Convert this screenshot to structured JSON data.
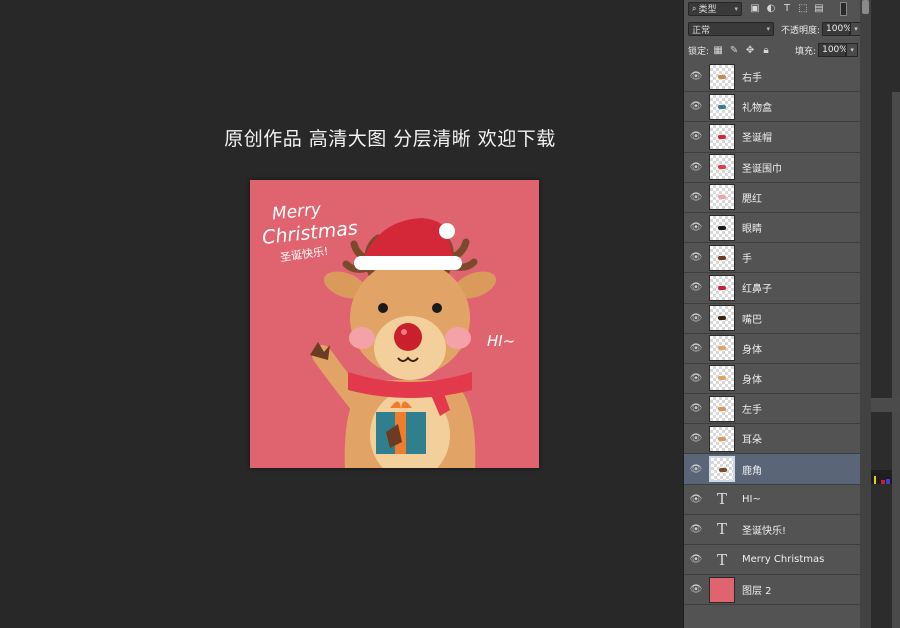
{
  "canvas": {
    "promo_text": "原创作品 高清大图 分层清晰 欢迎下载",
    "artwork": {
      "background_color": "#df6470",
      "merry": "Merry",
      "christmas": "Christmas",
      "greeting": "圣诞快乐!",
      "hi": "HI~"
    }
  },
  "layers_panel": {
    "filter_label": "类型",
    "blend_mode": "正常",
    "opacity_label": "不透明度:",
    "opacity_value": "100%",
    "lock_label": "锁定:",
    "fill_label": "填充:",
    "fill_value": "100%",
    "layers": [
      {
        "name": "右手",
        "kind": "pixel",
        "selected": false
      },
      {
        "name": "礼物盒",
        "kind": "pixel",
        "selected": false
      },
      {
        "name": "圣诞帽",
        "kind": "pixel",
        "selected": false
      },
      {
        "name": "圣诞围巾",
        "kind": "pixel",
        "selected": false
      },
      {
        "name": "腮红",
        "kind": "pixel",
        "selected": false
      },
      {
        "name": "眼睛",
        "kind": "pixel",
        "selected": false
      },
      {
        "name": "手",
        "kind": "pixel",
        "selected": false
      },
      {
        "name": "红鼻子",
        "kind": "pixel",
        "selected": false
      },
      {
        "name": "嘴巴",
        "kind": "pixel",
        "selected": false
      },
      {
        "name": "身体",
        "kind": "pixel",
        "selected": false
      },
      {
        "name": "身体",
        "kind": "pixel",
        "selected": false
      },
      {
        "name": "左手",
        "kind": "pixel",
        "selected": false
      },
      {
        "name": "耳朵",
        "kind": "pixel",
        "selected": false
      },
      {
        "name": "鹿角",
        "kind": "pixel",
        "selected": true
      },
      {
        "name": "HI~",
        "kind": "text",
        "selected": false
      },
      {
        "name": "圣诞快乐!",
        "kind": "text",
        "selected": false
      },
      {
        "name": "Merry  Christmas",
        "kind": "text",
        "selected": false
      },
      {
        "name": "图层 2",
        "kind": "fill",
        "selected": false
      }
    ]
  },
  "colors": {
    "workspace": "#282828",
    "panel": "#535353",
    "selected_row": "#5a6678",
    "artwork_bg": "#df6470"
  }
}
